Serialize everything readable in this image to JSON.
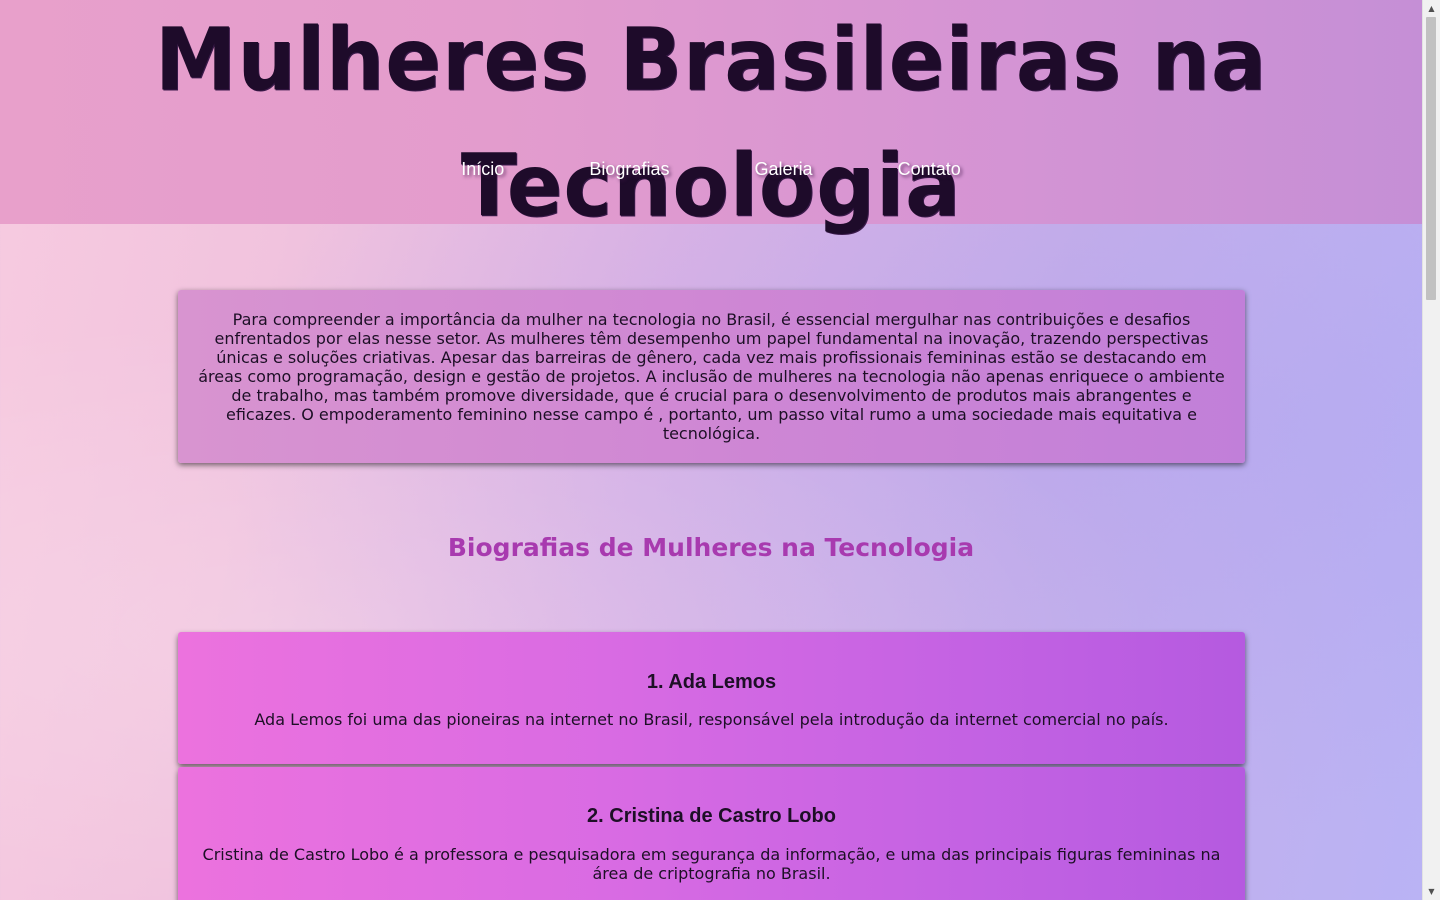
{
  "header": {
    "title": "Mulheres Brasileiras na Tecnologia",
    "nav": [
      {
        "label": "Início"
      },
      {
        "label": "Biografias"
      },
      {
        "label": "Galeria"
      },
      {
        "label": "Contato"
      }
    ]
  },
  "intro": {
    "text": "Para compreender a importância da mulher na tecnologia no Brasil, é essencial mergulhar nas contribuições e desafios enfrentados por elas nesse setor. As mulheres têm desempenho um papel fundamental na inovação, trazendo perspectivas únicas e soluções criativas. Apesar das barreiras de gênero, cada vez mais profissionais femininas estão se destacando em áreas como programação, design e gestão de projetos. A inclusão de mulheres na tecnologia não apenas enriquece o ambiente de trabalho, mas também promove diversidade, que é crucial para o desenvolvimento de produtos mais abrangentes e eficazes. O empoderamento feminino nesse campo é , portanto, um passo vital rumo a uma sociedade mais equitativa e tecnológica."
  },
  "biographies": {
    "section_title": "Biografias de Mulheres na Tecnologia",
    "items": [
      {
        "name": "1. Ada Lemos",
        "text": "Ada Lemos foi uma das pioneiras na internet no Brasil, responsável pela introdução da internet comercial no país."
      },
      {
        "name": "2. Cristina de Castro Lobo",
        "text": "Cristina de Castro Lobo é a professora e pesquisadora em segurança da informação, e uma das principais figuras femininas na área de criptografia no Brasil."
      }
    ]
  },
  "scrollbar": {
    "up_icon": "scroll-up-arrow",
    "down_icon": "scroll-down-arrow"
  }
}
